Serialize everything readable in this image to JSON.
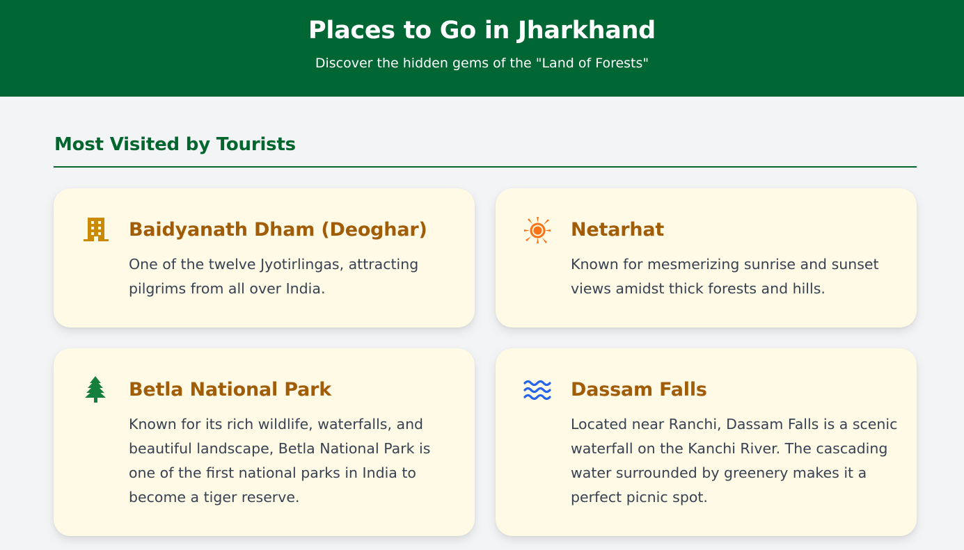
{
  "header": {
    "title": "Places to Go in Jharkhand",
    "subtitle": "Discover the hidden gems of the \"Land of Forests\""
  },
  "section": {
    "title": "Most Visited by Tourists"
  },
  "places": [
    {
      "icon": "building-icon",
      "icon_color": "#ca8a04",
      "title": "Baidyanath Dham (Deoghar)",
      "description": "One of the twelve Jyotirlingas, attracting pilgrims from all over India."
    },
    {
      "icon": "sun-icon",
      "icon_color": "#f97316",
      "title": "Netarhat",
      "description": "Known for mesmerizing sunrise and sunset views amidst thick forests and hills."
    },
    {
      "icon": "tree-icon",
      "icon_color": "#15803d",
      "title": "Betla National Park",
      "description": "Known for its rich wildlife, waterfalls, and beautiful landscape, Betla National Park is one of the first national parks in India to become a tiger reserve."
    },
    {
      "icon": "water-icon",
      "icon_color": "#2563eb",
      "title": "Dassam Falls",
      "description": "Located near Ranchi, Dassam Falls is a scenic waterfall on the Kanchi River. The cascading water surrounded by greenery makes it a perfect picnic spot."
    }
  ],
  "colors": {
    "brand_green": "#006633",
    "card_background": "#fefae6",
    "card_title": "#a15c07",
    "body_text": "#374151",
    "page_background": "#f3f4f6"
  }
}
